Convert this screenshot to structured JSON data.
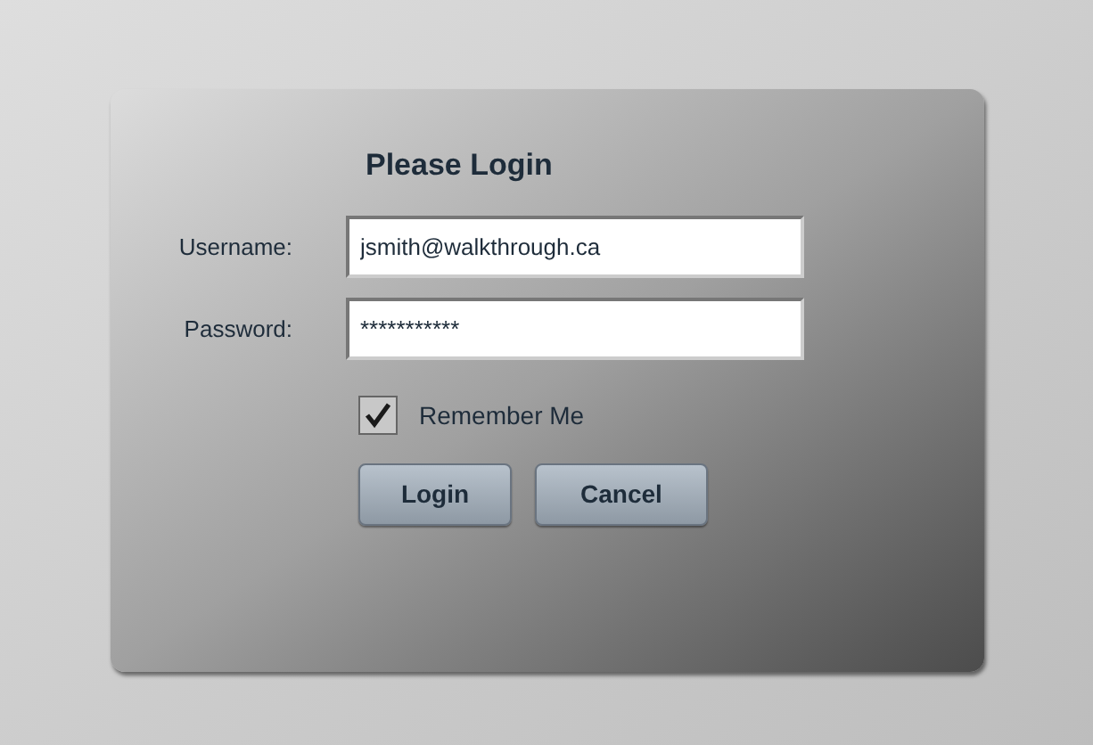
{
  "dialog": {
    "title": "Please Login",
    "fields": [
      {
        "label": "Username:",
        "value": "jsmith@walkthrough.ca"
      },
      {
        "label": "Password:",
        "value": "***********"
      }
    ],
    "remember": {
      "label": "Remember Me",
      "checked": true
    },
    "buttons": [
      "Login",
      "Cancel"
    ]
  }
}
